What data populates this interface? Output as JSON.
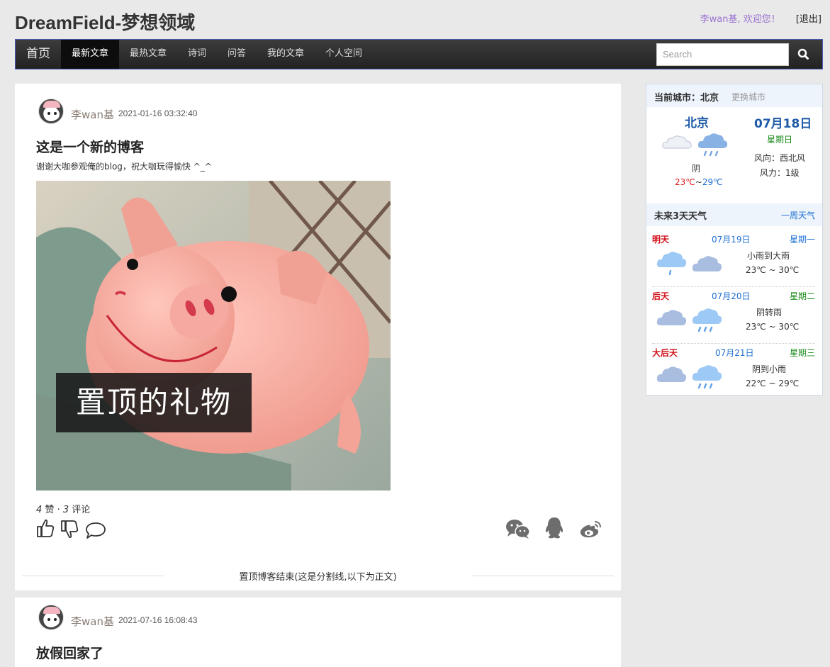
{
  "site": {
    "title": "DreamField-梦想领域"
  },
  "user": {
    "welcome": "李wan基, 欢迎您！",
    "logout": "[退出]"
  },
  "nav": {
    "home": "首页",
    "items": [
      "最新文章",
      "最热文章",
      "诗词",
      "问答",
      "我的文章",
      "个人空间"
    ],
    "active_index": 0,
    "search_placeholder": "Search"
  },
  "posts": [
    {
      "author": "李wan基",
      "date": "2021-01-16 03:32:40",
      "title": "这是一个新的博客",
      "summary": "谢谢大咖参观俺的blog，祝大咖玩得愉快 ^_^",
      "image_caption": "置顶的礼物",
      "likes": "4",
      "likes_label": "赞",
      "comments": "3",
      "comments_label": "评论"
    },
    {
      "author": "李wan基",
      "date": "2021-07-16 16:08:43",
      "title": "放假回家了"
    }
  ],
  "divider_text": "置顶博客结束(这是分割线,以下为正文)",
  "weather": {
    "current_label": "当前城市：北京",
    "change_city": "更换城市",
    "city": "北京",
    "date": "07月18日",
    "weekday": "星期日",
    "wind_dir": "风向：西北风",
    "wind_force": "风力：1级",
    "condition": "阴",
    "temp_low": "23℃",
    "temp_sep": "~",
    "temp_high": "29℃",
    "forecast_label": "未来3天天气",
    "week_link": "一周天气",
    "forecast": [
      {
        "name": "明天",
        "date": "07月19日",
        "weekday": "星期一",
        "condition": "小雨到大雨",
        "temp": "23℃ ~ 30℃"
      },
      {
        "name": "后天",
        "date": "07月20日",
        "weekday": "星期二",
        "condition": "阴转雨",
        "temp": "23℃ ~ 30℃"
      },
      {
        "name": "大后天",
        "date": "07月21日",
        "weekday": "星期三",
        "condition": "阴到小雨",
        "temp": "22℃ ~ 29℃"
      }
    ]
  }
}
